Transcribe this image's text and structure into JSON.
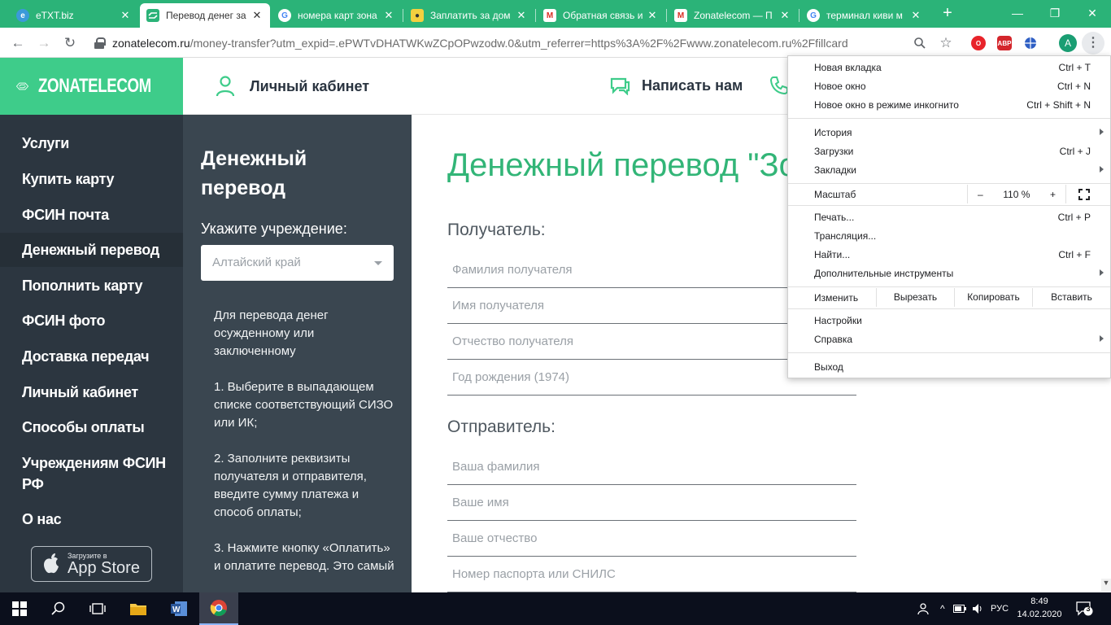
{
  "browser": {
    "tabs": [
      {
        "label": "eTXT.biz",
        "icon": "etxt-icon",
        "color": "#3b9ad9"
      },
      {
        "label": "Перевод денег за",
        "icon": "zonatelecom-icon",
        "color": "#2bb378"
      },
      {
        "label": "номера карт зона",
        "icon": "google-icon",
        "color": "#ffffff"
      },
      {
        "label": "Заплатить за дом",
        "icon": "lock-yellow-icon",
        "color": "#f4b400"
      },
      {
        "label": "Обратная связь и",
        "icon": "gmail-icon",
        "color": "#ffffff"
      },
      {
        "label": "Zonatelecom — П",
        "icon": "gmail-icon",
        "color": "#ffffff"
      },
      {
        "label": "терминал киви м",
        "icon": "google-icon",
        "color": "#ffffff"
      }
    ],
    "tab_close": "✕",
    "new_tab": "+",
    "window_controls": {
      "minimize": "—",
      "maximize": "❐",
      "close": "✕"
    },
    "url_host": "zonatelecom.ru",
    "url_rest": "/money-transfer?utm_expid=.ePWTvDHATWKwZCpOPwzodw.0&utm_referrer=https%3A%2F%2Fwww.zonatelecom.ru%2Ffillcard",
    "extensions": {
      "abp": "ABP"
    },
    "avatar": "A"
  },
  "site": {
    "logo": "ZONATELECOM",
    "header_links": [
      {
        "label": "Личный кабинет",
        "icon": "user-icon"
      },
      {
        "label": "Написать нам",
        "icon": "chat-icon"
      }
    ],
    "nav": [
      "Услуги",
      "Купить карту",
      "ФСИН почта",
      "Денежный перевод",
      "Пополнить карту",
      "ФСИН фото",
      "Доставка передач",
      "Личный кабинет",
      "Способы оплаты",
      "Учреждениям ФСИН РФ",
      "О нас"
    ],
    "appstore": {
      "small": "Загрузите в",
      "big": "App Store"
    },
    "info": {
      "title": "Денежный перевод",
      "select_label": "Укажите учреждение:",
      "select_value": "Алтайский край",
      "paragraphs": [
        "Для перевода денег осужденному или заключенному",
        "1. Выберите в выпадающем списке соответствующий СИЗО или ИК;",
        "2. Заполните реквизиты получателя и отправителя, введите сумму платежа и способ оплаты;",
        "3. Нажмите кнопку «Оплатить» и оплатите перевод. Это самый"
      ]
    },
    "form": {
      "title": "Денежный перевод \"Зо",
      "recipient_heading": "Получатель:",
      "recipient_fields": [
        "Фамилия получателя",
        "Имя получателя",
        "Отчество получателя",
        "Год рождения (1974)"
      ],
      "sender_heading": "Отправитель:",
      "sender_fields": [
        "Ваша фамилия",
        "Ваше имя",
        "Ваше отчество",
        "Номер паспорта или СНИЛС"
      ]
    }
  },
  "menu": {
    "items1": [
      {
        "label": "Новая вкладка",
        "shortcut": "Ctrl + T"
      },
      {
        "label": "Новое окно",
        "shortcut": "Ctrl + N"
      },
      {
        "label": "Новое окно в режиме инкогнито",
        "shortcut": "Ctrl + Shift + N"
      }
    ],
    "items2": [
      {
        "label": "История",
        "shortcut": ""
      },
      {
        "label": "Загрузки",
        "shortcut": "Ctrl + J"
      },
      {
        "label": "Закладки",
        "shortcut": ""
      }
    ],
    "zoom_label": "Масштаб",
    "zoom_minus": "–",
    "zoom_value": "110 %",
    "zoom_plus": "+",
    "items3": [
      {
        "label": "Печать...",
        "shortcut": "Ctrl + P"
      },
      {
        "label": "Трансляция...",
        "shortcut": ""
      },
      {
        "label": "Найти...",
        "shortcut": "Ctrl + F"
      },
      {
        "label": "Дополнительные инструменты",
        "shortcut": ""
      }
    ],
    "edit_label": "Изменить",
    "edit_buttons": [
      "Вырезать",
      "Копировать",
      "Вставить"
    ],
    "items4": [
      {
        "label": "Настройки",
        "shortcut": ""
      },
      {
        "label": "Справка",
        "shortcut": ""
      }
    ],
    "exit": "Выход"
  },
  "taskbar": {
    "lang": "РУС",
    "time": "8:49",
    "date": "14.02.2020",
    "notifications": "3"
  }
}
